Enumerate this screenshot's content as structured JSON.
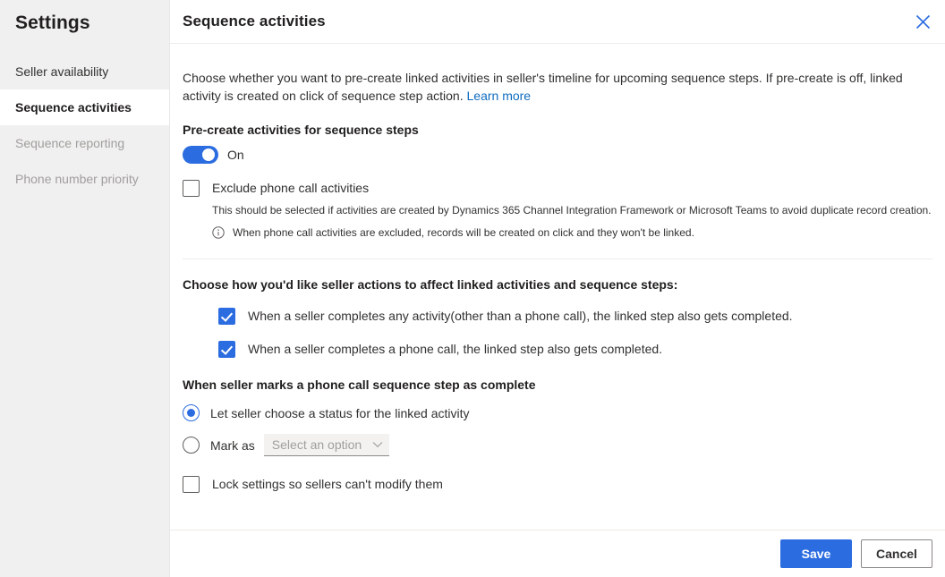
{
  "sidebar": {
    "title": "Settings",
    "items": [
      {
        "label": "Seller availability",
        "state": "normal"
      },
      {
        "label": "Sequence activities",
        "state": "active"
      },
      {
        "label": "Sequence reporting",
        "state": "disabled"
      },
      {
        "label": "Phone number priority",
        "state": "disabled"
      }
    ]
  },
  "panel": {
    "title": "Sequence activities",
    "close_icon": "close-icon",
    "intro": {
      "text": "Choose whether you want to pre-create linked activities in seller's timeline for upcoming sequence steps. If pre-create is off, linked activity is created on click of sequence step action.",
      "link_label": "Learn more"
    },
    "precreate": {
      "label": "Pre-create activities for sequence steps",
      "toggle_state": "On",
      "toggle_on": true
    },
    "exclude": {
      "label": "Exclude phone call activities",
      "checked": false,
      "helper": "This should be selected if activities are created by Dynamics 365 Channel Integration Framework or Microsoft Teams to avoid duplicate record creation.",
      "info_icon": "info-icon",
      "info": "When phone call activities are excluded, records will be created on click and they won't be linked."
    },
    "seller_actions": {
      "heading": "Choose how you'd like seller actions to affect linked activities and sequence steps:",
      "options": [
        {
          "label": "When a seller completes any activity(other than a phone call), the linked step also gets completed.",
          "checked": true
        },
        {
          "label": "When a seller completes a phone call, the linked step also gets completed.",
          "checked": true
        }
      ]
    },
    "phone_complete": {
      "heading": "When seller marks a phone call sequence step as complete",
      "option_let_seller": {
        "label": "Let seller choose a status for the linked activity",
        "selected": true
      },
      "option_mark_as": {
        "label": "Mark as",
        "selected": false
      },
      "select_placeholder": "Select an option",
      "chevron_icon": "chevron-down-icon"
    },
    "lock": {
      "label": "Lock settings so sellers can't modify them",
      "checked": false
    },
    "footer": {
      "save_label": "Save",
      "cancel_label": "Cancel"
    }
  },
  "colors": {
    "accent": "#2b6ce0",
    "link": "#0f6cbd",
    "sidebar_bg": "#f0f0f0",
    "divider": "#edebe9",
    "disabled_text": "#a19f9d"
  }
}
